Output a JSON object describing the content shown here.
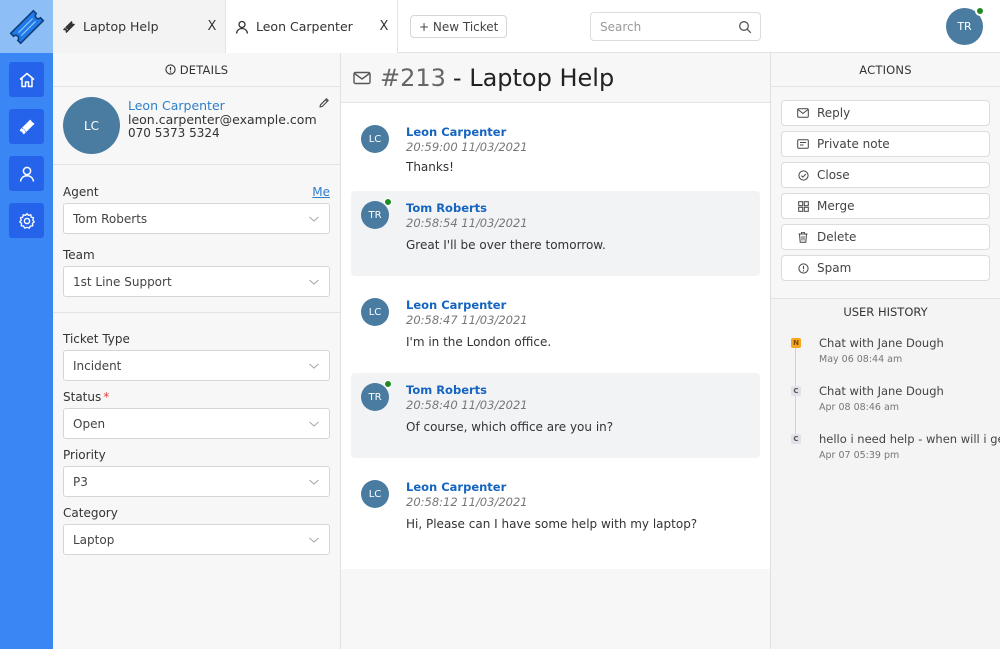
{
  "topbar": {
    "tabs": [
      {
        "label": "Laptop Help",
        "icon": "ticket-icon",
        "close": "X"
      },
      {
        "label": "Leon Carpenter",
        "icon": "user-icon",
        "close": "X"
      }
    ],
    "new_ticket_label": "+ New Ticket",
    "search_placeholder": "Search",
    "user_initials": "TR"
  },
  "sidebar": {
    "items": [
      {
        "name": "home",
        "icon": "home-icon"
      },
      {
        "name": "tickets",
        "icon": "ticket-icon"
      },
      {
        "name": "users",
        "icon": "user-icon"
      },
      {
        "name": "settings",
        "icon": "gear-icon"
      }
    ]
  },
  "details": {
    "header": "DETAILS",
    "contact": {
      "initials": "LC",
      "name": "Leon Carpenter",
      "email": "leon.carpenter@example.com",
      "phone": "070 5373 5324"
    },
    "agent": {
      "label": "Agent",
      "me_link": "Me",
      "value": "Tom Roberts"
    },
    "team": {
      "label": "Team",
      "value": "1st Line Support"
    },
    "ticket_type": {
      "label": "Ticket Type",
      "value": "Incident"
    },
    "status": {
      "label": "Status",
      "required_mark": "*",
      "value": "Open"
    },
    "priority": {
      "label": "Priority",
      "value": "P3"
    },
    "category": {
      "label": "Category",
      "value": "Laptop"
    }
  },
  "conversation": {
    "ticket_number": "#213",
    "title": "- Laptop Help",
    "messages": [
      {
        "initials": "LC",
        "author": "Leon Carpenter",
        "time": "20:59:00 11/03/2021",
        "text": "Thanks!",
        "agent": false
      },
      {
        "initials": "TR",
        "author": "Tom Roberts",
        "time": "20:58:54 11/03/2021",
        "text": "Great I'll be over there tomorrow.",
        "agent": true
      },
      {
        "initials": "LC",
        "author": "Leon Carpenter",
        "time": "20:58:47 11/03/2021",
        "text": "I'm in the London office.",
        "agent": false
      },
      {
        "initials": "TR",
        "author": "Tom Roberts",
        "time": "20:58:40 11/03/2021",
        "text": "Of course, which office are you in?",
        "agent": true
      },
      {
        "initials": "LC",
        "author": "Leon Carpenter",
        "time": "20:58:12 11/03/2021",
        "text": "Hi, Please can I have some help with my laptop?",
        "agent": false
      }
    ]
  },
  "actions": {
    "header": "ACTIONS",
    "buttons": [
      {
        "label": "Reply",
        "icon": "mail-icon"
      },
      {
        "label": "Private note",
        "icon": "note-icon"
      },
      {
        "label": "Close",
        "icon": "check-circle-icon"
      },
      {
        "label": "Merge",
        "icon": "merge-icon"
      },
      {
        "label": "Delete",
        "icon": "trash-icon"
      },
      {
        "label": "Spam",
        "icon": "alert-circle-icon"
      }
    ]
  },
  "user_history": {
    "header": "USER HISTORY",
    "items": [
      {
        "badge": "N",
        "title": "Chat with Jane Dough",
        "date": "May 06 08:44 am"
      },
      {
        "badge": "C",
        "title": "Chat with Jane Dough",
        "date": "Apr 08 08:46 am"
      },
      {
        "badge": "C",
        "title": "hello i need help - when will i get",
        "date": "Apr 07 05:39 pm"
      }
    ]
  },
  "colors": {
    "sidebar": "#3b86f5",
    "sidebar_button": "#2563eb",
    "avatar": "#4a7ba0",
    "link": "#2f80c9",
    "author": "#1565c0",
    "online": "#1f8a1f",
    "badge_new": "#f5a623"
  }
}
